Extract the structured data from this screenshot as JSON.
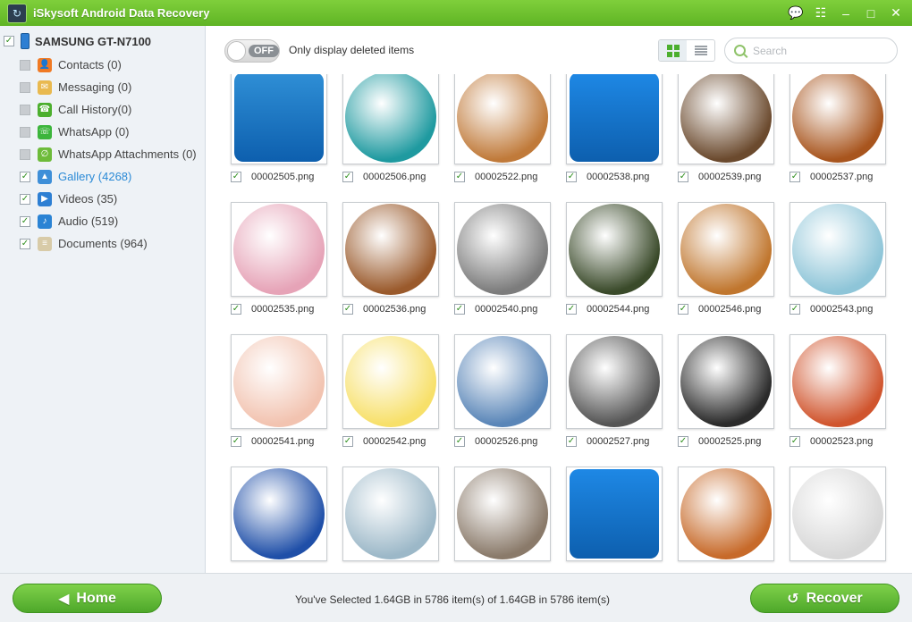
{
  "window": {
    "title": "iSkysoft Android Data Recovery",
    "buttons": [
      "chat-icon",
      "feedback-icon",
      "minimize-icon",
      "maximize-icon",
      "close-icon"
    ]
  },
  "sidebar": {
    "device": {
      "name": "SAMSUNG GT-N7100",
      "checked": true
    },
    "items": [
      {
        "label": "Contacts (0)",
        "checked": false,
        "icon": "contacts-icon",
        "color": "#f07a24",
        "glyph": "👤"
      },
      {
        "label": "Messaging (0)",
        "checked": false,
        "icon": "messaging-icon",
        "color": "#e9b94f",
        "glyph": "✉"
      },
      {
        "label": "Call History(0)",
        "checked": false,
        "icon": "call-history-icon",
        "color": "#4caf2e",
        "glyph": "☎"
      },
      {
        "label": "WhatsApp (0)",
        "checked": false,
        "icon": "whatsapp-icon",
        "color": "#3cb53c",
        "glyph": "☏"
      },
      {
        "label": "WhatsApp Attachments (0)",
        "checked": false,
        "icon": "attachment-icon",
        "color": "#6dbb3a",
        "glyph": "∅"
      },
      {
        "label": "Gallery (4268)",
        "checked": true,
        "active": true,
        "icon": "gallery-icon",
        "color": "#3e8fd8",
        "glyph": "▲"
      },
      {
        "label": "Videos (35)",
        "checked": true,
        "icon": "videos-icon",
        "color": "#2d7fd3",
        "glyph": "▶"
      },
      {
        "label": "Audio (519)",
        "checked": true,
        "icon": "audio-icon",
        "color": "#2a83d4",
        "glyph": "♪"
      },
      {
        "label": "Documents (964)",
        "checked": true,
        "icon": "documents-icon",
        "color": "#d8cba8",
        "glyph": "≡"
      }
    ]
  },
  "toolbar": {
    "toggle_text": "OFF",
    "toggle_label": "Only display deleted items",
    "search_placeholder": "Search"
  },
  "gallery": {
    "items": [
      {
        "name": "00002505.png",
        "kind": "app",
        "bg": "#2f8fd6"
      },
      {
        "name": "00002506.png",
        "kind": "circle",
        "bg": "#1f9aa0"
      },
      {
        "name": "00002522.png",
        "kind": "circle",
        "bg": "#c07a3a"
      },
      {
        "name": "00002538.png",
        "kind": "app",
        "bg": "#1e88e5"
      },
      {
        "name": "00002539.png",
        "kind": "circle",
        "bg": "#6b4a2e"
      },
      {
        "name": "00002537.png",
        "kind": "circle",
        "bg": "#a8551e"
      },
      {
        "name": "00002535.png",
        "kind": "circle",
        "bg": "#e6a3b7"
      },
      {
        "name": "00002536.png",
        "kind": "circle",
        "bg": "#9a5a2c"
      },
      {
        "name": "00002540.png",
        "kind": "circle",
        "bg": "#7c7c7c"
      },
      {
        "name": "00002544.png",
        "kind": "circle",
        "bg": "#3a4a2a"
      },
      {
        "name": "00002546.png",
        "kind": "circle",
        "bg": "#c0762e"
      },
      {
        "name": "00002543.png",
        "kind": "circle",
        "bg": "#8ec5d8"
      },
      {
        "name": "00002541.png",
        "kind": "circle",
        "bg": "#f2c3b0"
      },
      {
        "name": "00002542.png",
        "kind": "circle",
        "bg": "#f7e06a"
      },
      {
        "name": "00002526.png",
        "kind": "circle",
        "bg": "#5a86b8"
      },
      {
        "name": "00002527.png",
        "kind": "circle",
        "bg": "#555555"
      },
      {
        "name": "00002525.png",
        "kind": "circle",
        "bg": "#2b2b2b"
      },
      {
        "name": "00002523.png",
        "kind": "circle",
        "bg": "#d0552e"
      },
      {
        "name": "",
        "kind": "circle",
        "bg": "#1f4fa8"
      },
      {
        "name": "",
        "kind": "circle",
        "bg": "#9cb8c8"
      },
      {
        "name": "",
        "kind": "circle",
        "bg": "#8a7a6a"
      },
      {
        "name": "",
        "kind": "app",
        "bg": "#1e88e5"
      },
      {
        "name": "",
        "kind": "circle",
        "bg": "#c76a2a"
      },
      {
        "name": "",
        "kind": "circle",
        "bg": "#d8d8d8"
      }
    ]
  },
  "footer": {
    "home_label": "Home",
    "recover_label": "Recover",
    "status": "You've Selected 1.64GB in 5786 item(s) of 1.64GB in 5786 item(s)"
  }
}
